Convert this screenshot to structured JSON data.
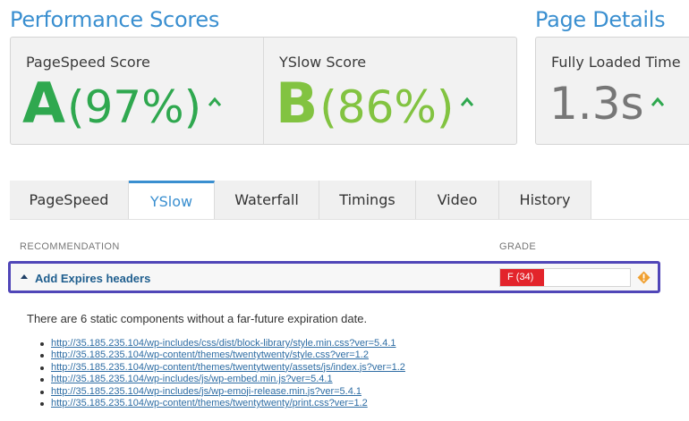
{
  "performance": {
    "title": "Performance Scores",
    "pagespeed": {
      "label": "PageSpeed Score",
      "grade": "A",
      "percent": "(97%)",
      "color": "#2fa84f"
    },
    "yslow": {
      "label": "YSlow Score",
      "grade": "B",
      "percent": "(86%)",
      "color": "#82c341"
    }
  },
  "page_details": {
    "title": "Page Details",
    "fully_loaded": {
      "label": "Fully Loaded Time",
      "value": "1.3s"
    }
  },
  "tabs": [
    {
      "label": "PageSpeed",
      "active": false
    },
    {
      "label": "YSlow",
      "active": true
    },
    {
      "label": "Waterfall",
      "active": false
    },
    {
      "label": "Timings",
      "active": false
    },
    {
      "label": "Video",
      "active": false
    },
    {
      "label": "History",
      "active": false
    }
  ],
  "table": {
    "col_recommendation": "RECOMMENDATION",
    "col_grade": "GRADE",
    "row": {
      "name": "Add Expires headers",
      "grade_text": "F (34)",
      "grade_value": 34,
      "grade_color": "#e3242b",
      "icon": "diamond-warning-icon"
    }
  },
  "detail": {
    "summary": "There are 6 static components without a far-future expiration date.",
    "links": [
      "http://35.185.235.104/wp-includes/css/dist/block-library/style.min.css?ver=5.4.1",
      "http://35.185.235.104/wp-content/themes/twentytwenty/style.css?ver=1.2",
      "http://35.185.235.104/wp-content/themes/twentytwenty/assets/js/index.js?ver=1.2",
      "http://35.185.235.104/wp-includes/js/wp-embed.min.js?ver=5.4.1",
      "http://35.185.235.104/wp-includes/js/wp-emoji-release.min.js?ver=5.4.1",
      "http://35.185.235.104/wp-content/themes/twentytwenty/print.css?ver=1.2"
    ]
  },
  "colors": {
    "accent": "#3a8fd0",
    "up_arrow": "#2fa84f",
    "highlight_border": "#5046b8",
    "warning": "#f0a030"
  }
}
